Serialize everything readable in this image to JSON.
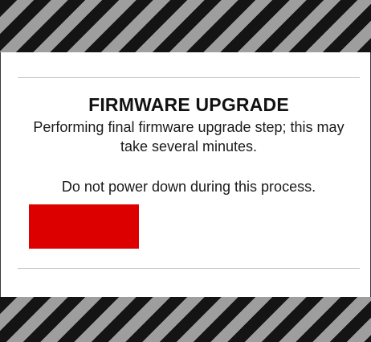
{
  "dialog": {
    "title": "FIRMWARE UPGRADE",
    "message": "Performing final firmware upgrade step; this may take several minutes.",
    "warning": "Do not power down during this process."
  },
  "progress": {
    "fraction": 0.35,
    "color": "#dd0000"
  },
  "colors": {
    "hazard_dark": "#141414",
    "hazard_light": "#9e9e9e",
    "background": "#ffffff"
  }
}
